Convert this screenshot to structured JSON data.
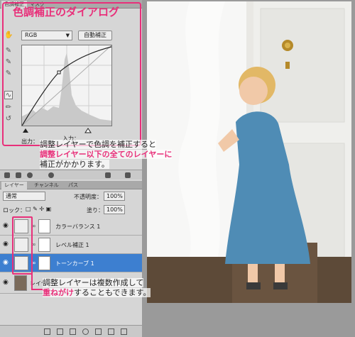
{
  "adjustments_panel": {
    "tabs": [
      "色調補正",
      "マスク"
    ],
    "title": "色調補正のダイアログ",
    "channel_select": "RGB",
    "auto_button": "自動補正",
    "output_label": "出力：",
    "input_label": "入力："
  },
  "annotation_top": {
    "line1": "調整レイヤーで色調を補正すると",
    "line2": "調整レイヤー以下の全てのレイヤーに",
    "line3": "補正がかかります。"
  },
  "layers_panel": {
    "tabs": [
      "レイヤー",
      "チャンネル",
      "パス"
    ],
    "blend_mode": "通常",
    "opacity_label": "不透明度：",
    "opacity_value": "100%",
    "lock_label": "ロック：",
    "fill_label": "塗り：",
    "fill_value": "100%",
    "layers": [
      {
        "name": "カラーバランス 1"
      },
      {
        "name": "レベル補正 1"
      },
      {
        "name": "トーンカーブ 1"
      },
      {
        "name": "レイヤー"
      }
    ]
  },
  "annotation_bottom": {
    "line1": "調整レイヤーは複数作成して",
    "line2_pink": "重ねがけ",
    "line2_rest": "することもできます。"
  },
  "colors": {
    "accent": "#e8307a",
    "selected_layer": "#3d7fd0"
  }
}
